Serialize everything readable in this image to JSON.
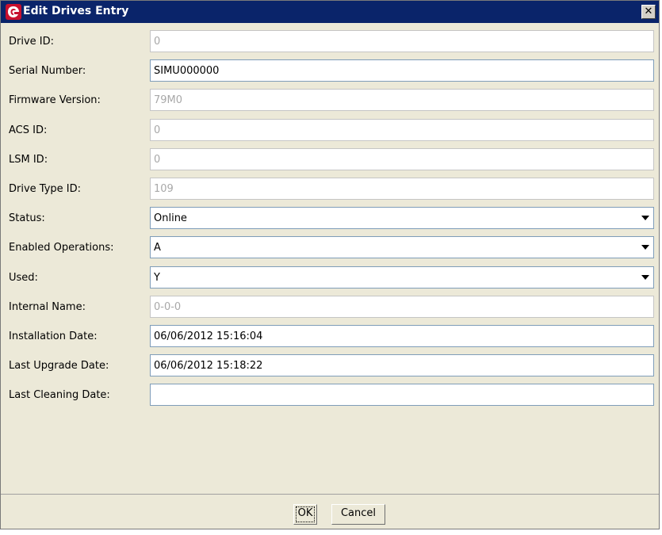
{
  "window": {
    "title": "Edit Drives Entry",
    "close_symbol": "✕"
  },
  "fields": [
    {
      "label": "Drive ID:",
      "value": "0",
      "type": "text",
      "enabled": false
    },
    {
      "label": "Serial Number:",
      "value": "SIMU000000",
      "type": "text",
      "enabled": true
    },
    {
      "label": "Firmware Version:",
      "value": "79M0",
      "type": "text",
      "enabled": false
    },
    {
      "label": "ACS ID:",
      "value": "0",
      "type": "text",
      "enabled": false
    },
    {
      "label": "LSM ID:",
      "value": "0",
      "type": "text",
      "enabled": false
    },
    {
      "label": "Drive Type ID:",
      "value": "109",
      "type": "text",
      "enabled": false
    },
    {
      "label": "Status:",
      "value": "Online",
      "type": "select",
      "enabled": true
    },
    {
      "label": "Enabled Operations:",
      "value": "A",
      "type": "select",
      "enabled": true
    },
    {
      "label": "Used:",
      "value": "Y",
      "type": "select",
      "enabled": true
    },
    {
      "label": "Internal Name:",
      "value": "0-0-0",
      "type": "text",
      "enabled": false
    },
    {
      "label": "Installation Date:",
      "value": "06/06/2012 15:16:04",
      "type": "text",
      "enabled": true
    },
    {
      "label": "Last Upgrade Date:",
      "value": "06/06/2012 15:18:22",
      "type": "text",
      "enabled": true
    },
    {
      "label": "Last Cleaning Date:",
      "value": "",
      "type": "text",
      "enabled": true
    }
  ],
  "buttons": {
    "ok": "OK",
    "cancel": "Cancel"
  },
  "colors": {
    "titlebar": "#0a246a",
    "window_bg": "#ece9d8",
    "disabled_text": "#a8a8a8"
  },
  "icons": {
    "app": "red-app-logo-icon",
    "dropdown": "chevron-down-icon"
  }
}
